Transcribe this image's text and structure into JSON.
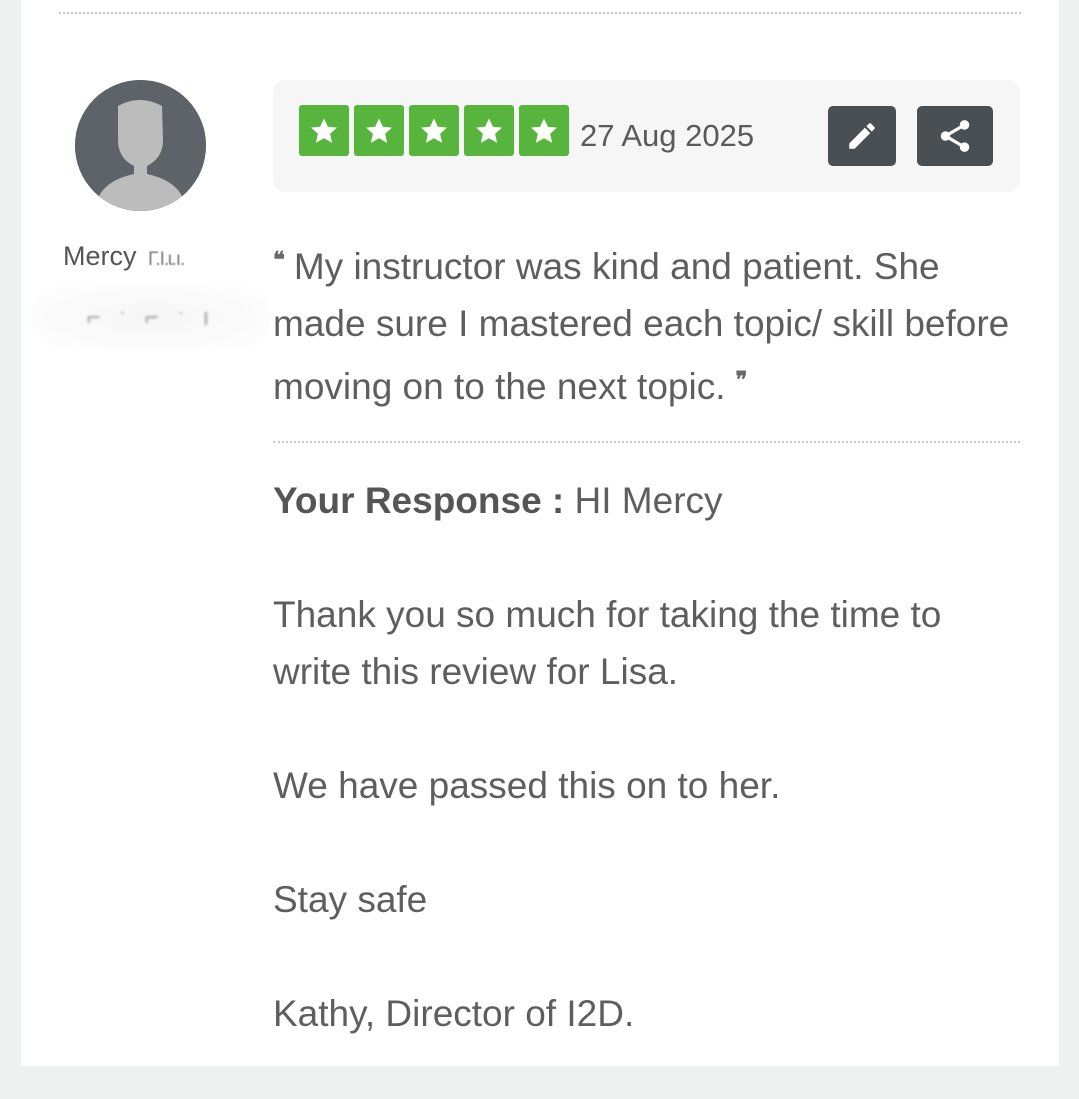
{
  "review": {
    "reviewer_first_name": "Mercy",
    "reviewer_surname_partial": "Γ.Ι.ɩ.ı.",
    "reviewer_location_partial": "⌐ ˑ ⌐ ˑ ı",
    "rating": 5,
    "rating_max": 5,
    "star_color": "#57b43c",
    "date": "27 Aug 2025",
    "quote_open": "❝",
    "text": "My instructor was kind and patient. She made sure I mastered each topic/ skill before moving on to the next topic.",
    "quote_close": "❞"
  },
  "actions": {
    "edit_icon": "pencil-icon",
    "share_icon": "share-icon",
    "button_color": "#4a4f54"
  },
  "response": {
    "label": "Your Response :",
    "greeting": "HI Mercy",
    "paragraphs": [
      "Thank you so much for taking the time to write this review for Lisa.",
      "We have passed this on to her.",
      "Stay safe",
      "Kathy, Director of I2D."
    ]
  }
}
